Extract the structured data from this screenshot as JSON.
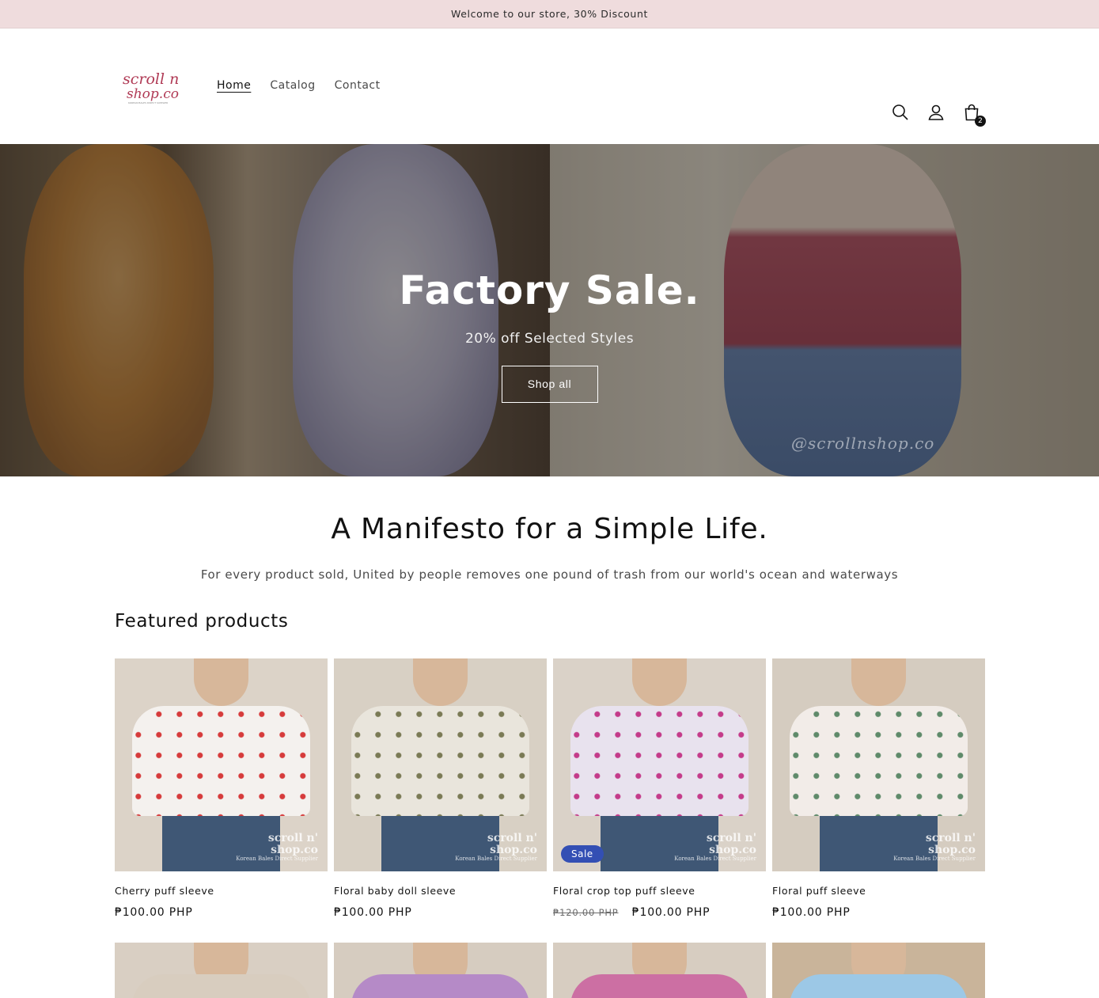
{
  "announcement": "Welcome to our store, 30% Discount",
  "header": {
    "logo_line1": "scroll n",
    "logo_line2": "shop.co",
    "logo_tagline": "KOREAN BALES DIRECT SUPPLIER",
    "nav": [
      {
        "label": "Home",
        "active": true
      },
      {
        "label": "Catalog",
        "active": false
      },
      {
        "label": "Contact",
        "active": false
      }
    ],
    "icons": [
      "search-icon",
      "account-icon",
      "cart-icon"
    ],
    "cart_count": "2"
  },
  "hero": {
    "title": "Factory Sale.",
    "subtitle": "20% off Selected Styles",
    "button": "Shop all",
    "watermark": "@scrollnshop.co"
  },
  "manifesto": {
    "title": "A Manifesto for a Simple Life.",
    "text": "For every product sold, United by people removes one pound of trash from our world's ocean and waterways"
  },
  "featured": {
    "title": "Featured products",
    "brand_mark": "scroll n'",
    "brand_mark2": "shop.co",
    "brand_tag": "Korean Bales Direct Supplier",
    "products": [
      {
        "title": "Cherry puff sleeve",
        "price": "₱100.00 PHP",
        "old_price": "",
        "sale": false,
        "shirt": "#f4f1ee",
        "accent": "#d63b3b",
        "bg": "#dcd3c8"
      },
      {
        "title": "Floral baby doll sleeve",
        "price": "₱100.00 PHP",
        "old_price": "",
        "sale": false,
        "shirt": "#e9e5dc",
        "accent": "#7a7a55",
        "bg": "#d8d0c4"
      },
      {
        "title": "Floral crop top puff sleeve",
        "price": "₱100.00 PHP",
        "old_price": "₱120.00 PHP",
        "sale": true,
        "sale_label": "Sale",
        "shirt": "#e8e2ee",
        "accent": "#c43b8a",
        "bg": "#dad2c8"
      },
      {
        "title": "Floral puff sleeve",
        "price": "₱100.00 PHP",
        "old_price": "",
        "sale": false,
        "shirt": "#f2ece8",
        "accent": "#5f8a6a",
        "bg": "#d5ccc0"
      }
    ],
    "row2": [
      {
        "shirt": "#d8cdbf",
        "bg": "#d9cfc3"
      },
      {
        "shirt": "#b58ac7",
        "bg": "#d6ccc0"
      },
      {
        "shirt": "#cc6fa3",
        "bg": "#d7cdc1"
      },
      {
        "shirt": "#9cc8e6",
        "bg": "#c9b49a"
      }
    ]
  }
}
